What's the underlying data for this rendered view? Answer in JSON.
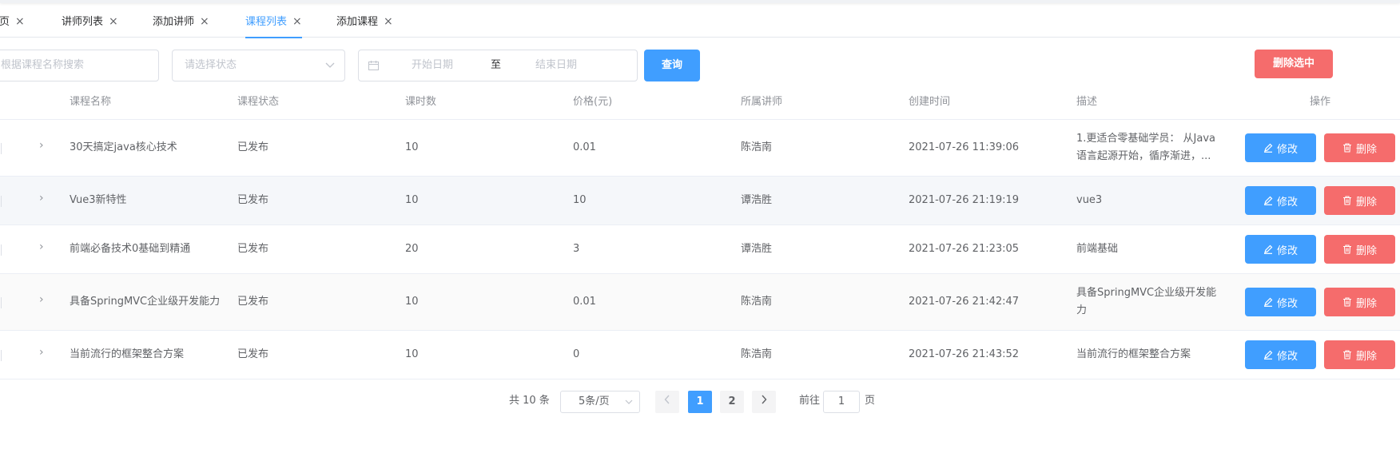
{
  "tabs": [
    {
      "label": "首页",
      "active": false
    },
    {
      "label": "讲师列表",
      "active": false
    },
    {
      "label": "添加讲师",
      "active": false
    },
    {
      "label": "课程列表",
      "active": true
    },
    {
      "label": "添加课程",
      "active": false
    }
  ],
  "filters": {
    "search_placeholder": "根据课程名称搜索",
    "status_placeholder": "请选择状态",
    "start_date_placeholder": "开始日期",
    "date_separator": "至",
    "end_date_placeholder": "结束日期",
    "query_label": "查询",
    "delete_selected_label": "删除选中"
  },
  "table": {
    "columns": [
      "课程名称",
      "课程状态",
      "课时数",
      "价格(元)",
      "所属讲师",
      "创建时间",
      "描述",
      "操作"
    ],
    "rows": [
      {
        "name": "30天搞定java核心技术",
        "status": "已发布",
        "lessons": "10",
        "price": "0.01",
        "teacher": "陈浩南",
        "created": "2021-07-26 11:39:06",
        "desc_line1": "1.更适合零基础学员： 从Java",
        "desc_line2": "语言起源开始，循序渐进，..."
      },
      {
        "name": "Vue3新特性",
        "status": "已发布",
        "lessons": "10",
        "price": "10",
        "teacher": "谭浩胜",
        "created": "2021-07-26 21:19:19",
        "desc_line1": "vue3",
        "desc_line2": ""
      },
      {
        "name": "前端必备技术0基础到精通",
        "status": "已发布",
        "lessons": "20",
        "price": "3",
        "teacher": "谭浩胜",
        "created": "2021-07-26 21:23:05",
        "desc_line1": "前端基础",
        "desc_line2": ""
      },
      {
        "name": "具备SpringMVC企业级开发能力",
        "status": "已发布",
        "lessons": "10",
        "price": "0.01",
        "teacher": "陈浩南",
        "created": "2021-07-26 21:42:47",
        "desc_line1": "具备SpringMVC企业级开发能",
        "desc_line2": "力"
      },
      {
        "name": "当前流行的框架整合方案",
        "status": "已发布",
        "lessons": "10",
        "price": "0",
        "teacher": "陈浩南",
        "created": "2021-07-26 21:43:52",
        "desc_line1": "当前流行的框架整合方案",
        "desc_line2": ""
      }
    ],
    "edit_label": "修改",
    "delete_label": "删除"
  },
  "pagination": {
    "total_text": "共 10 条",
    "page_size": "5条/页",
    "pages": [
      "1",
      "2"
    ],
    "current_page": "1",
    "goto_label": "前往",
    "goto_value": "1",
    "goto_unit": "页"
  },
  "colors": {
    "primary": "#409eff",
    "danger": "#f56c6c"
  }
}
